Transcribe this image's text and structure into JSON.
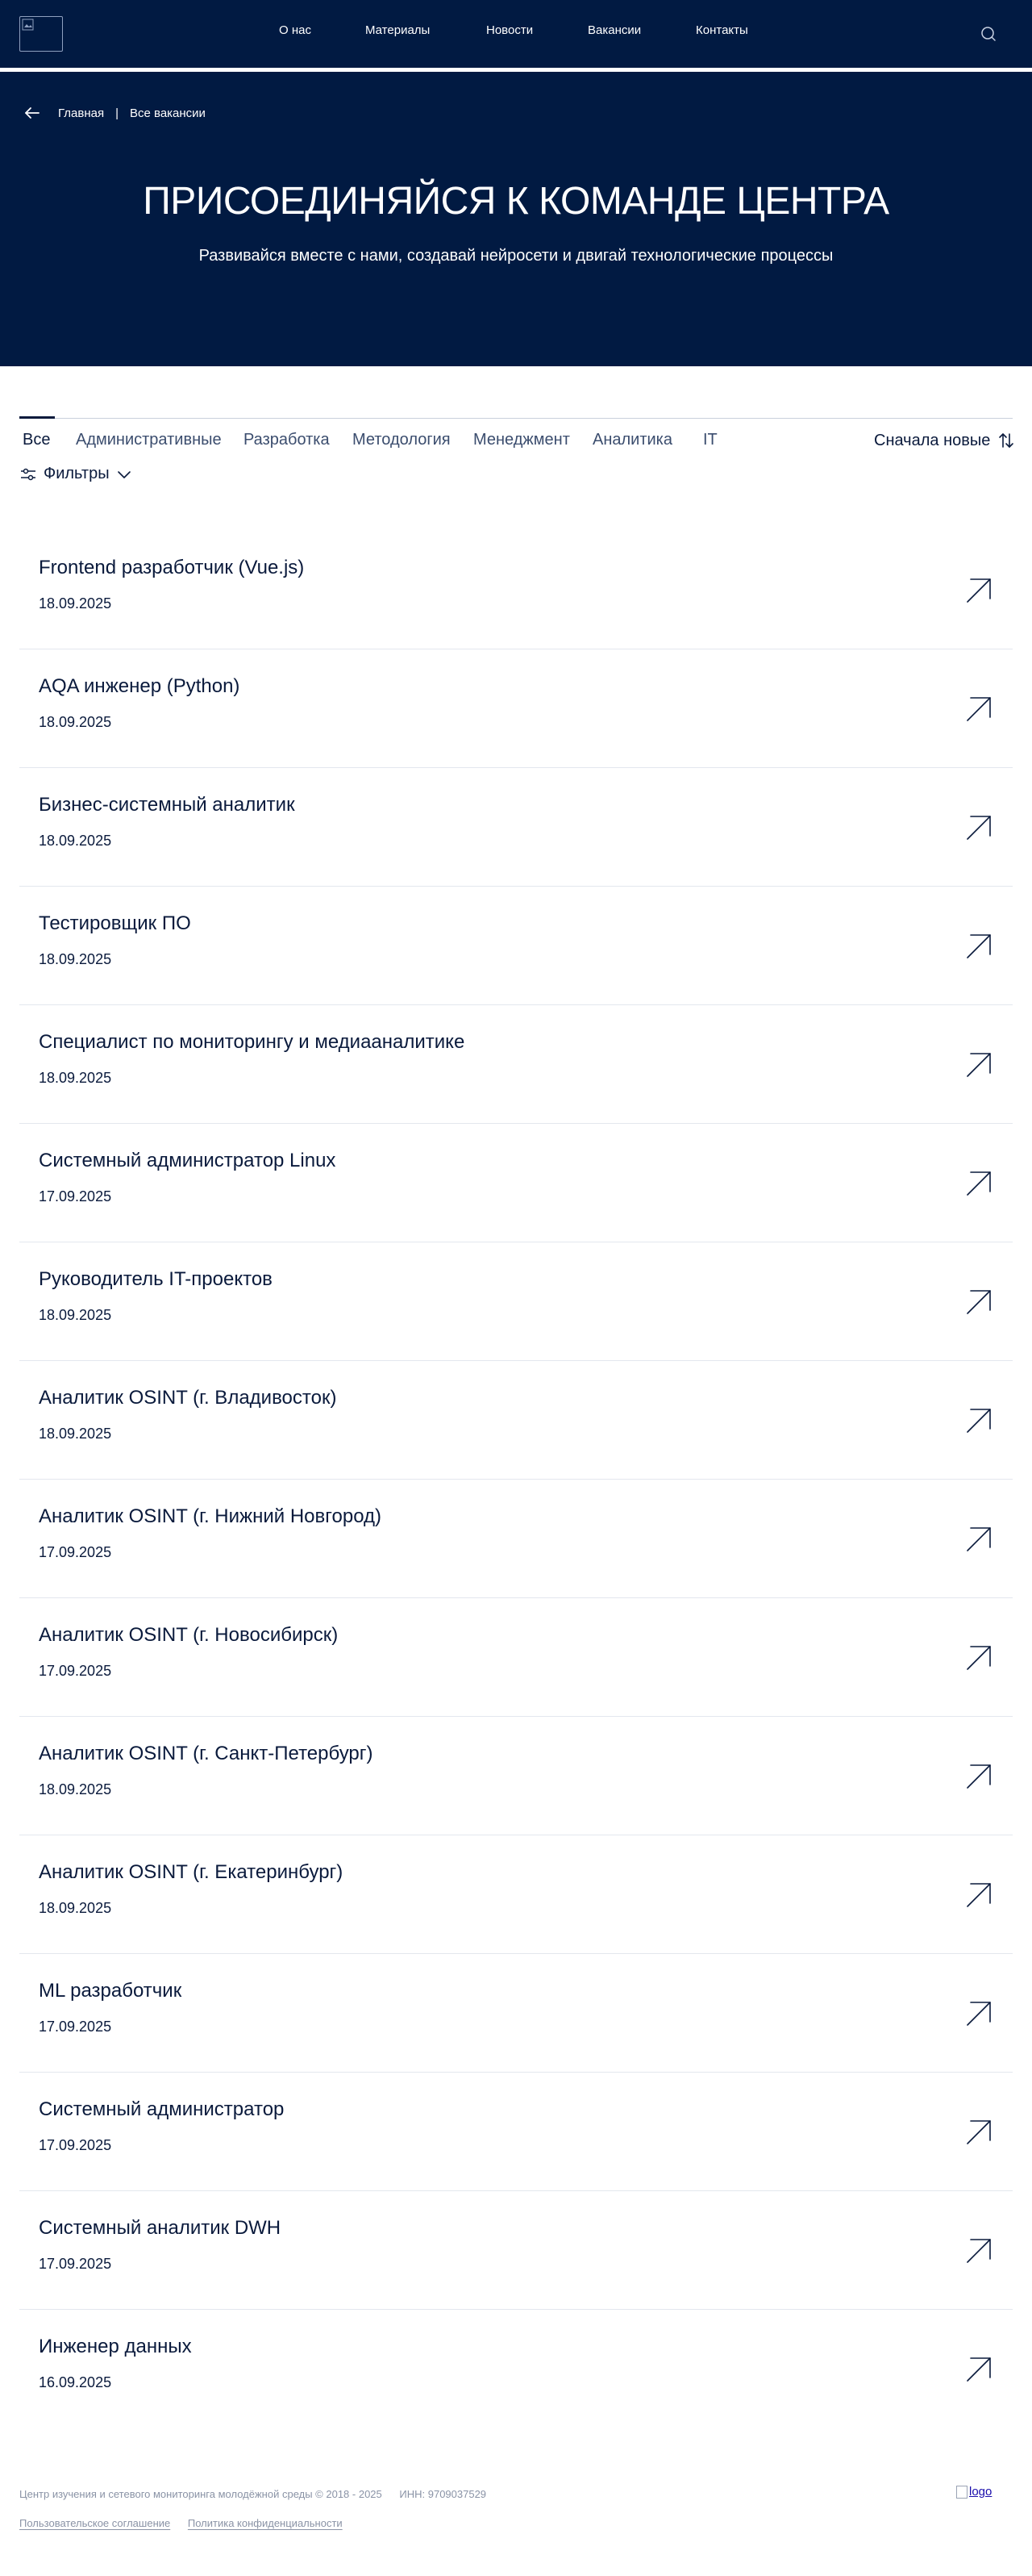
{
  "header": {
    "nav": [
      "О нас",
      "Материалы",
      "Новости",
      "Вакансии",
      "Контакты"
    ],
    "search_icon": "search-icon"
  },
  "breadcrumb": {
    "home": "Главная",
    "separator": "|",
    "current": "Все вакансии"
  },
  "hero": {
    "title": "ПРИСОЕДИНЯЙСЯ К КОМАНДЕ ЦЕНТРА",
    "subtitle": "Развивайся вместе с нами, создавай нейросети и двигай технологические процессы"
  },
  "tabs": [
    "Все",
    "Административные",
    "Разработка",
    "Методология",
    "Менеджмент",
    "Аналитика",
    "IT"
  ],
  "active_tab": "Все",
  "sort": {
    "label": "Сначала новые",
    "icon": "sort-arrows-icon"
  },
  "filters": {
    "label": "Фильтры",
    "icon": "sliders-icon"
  },
  "vacancies": [
    {
      "title": "Frontend разработчик (Vue.js)",
      "date": "18.09.2025"
    },
    {
      "title": "AQA инженер (Python)",
      "date": "18.09.2025"
    },
    {
      "title": "Бизнес-системный аналитик",
      "date": "18.09.2025"
    },
    {
      "title": "Тестировщик ПО",
      "date": "18.09.2025"
    },
    {
      "title": "Специалист по мониторингу и медиааналитике",
      "date": "18.09.2025"
    },
    {
      "title": "Системный администратор Linux",
      "date": "17.09.2025"
    },
    {
      "title": "Руководитель IT-проектов",
      "date": "18.09.2025"
    },
    {
      "title": "Аналитик OSINT (г. Владивосток)",
      "date": "18.09.2025"
    },
    {
      "title": "Аналитик OSINT (г. Нижний Новгород)",
      "date": "17.09.2025"
    },
    {
      "title": "Аналитик OSINT (г. Новосибирск)",
      "date": "17.09.2025"
    },
    {
      "title": "Аналитик OSINT (г. Санкт-Петербург)",
      "date": "18.09.2025"
    },
    {
      "title": "Аналитик OSINT (г. Екатеринбург)",
      "date": "18.09.2025"
    },
    {
      "title": "ML разработчик",
      "date": "17.09.2025"
    },
    {
      "title": "Системный администратор",
      "date": "17.09.2025"
    },
    {
      "title": "Системный аналитик DWH",
      "date": "17.09.2025"
    },
    {
      "title": "Инженер данных",
      "date": "16.09.2025"
    }
  ],
  "footer": {
    "copyright": "Центр изучения и сетевого мониторинга молодёжной среды © 2018 - 2025",
    "inn": "ИНН: 9709037529",
    "links": [
      "Пользовательское соглашение",
      "Политика конфиденциальности"
    ],
    "logo_alt": "logo"
  },
  "colors": {
    "header_bg": "#011a42",
    "text_dark": "#0a1a3c",
    "footer_text": "#8a93a6"
  }
}
